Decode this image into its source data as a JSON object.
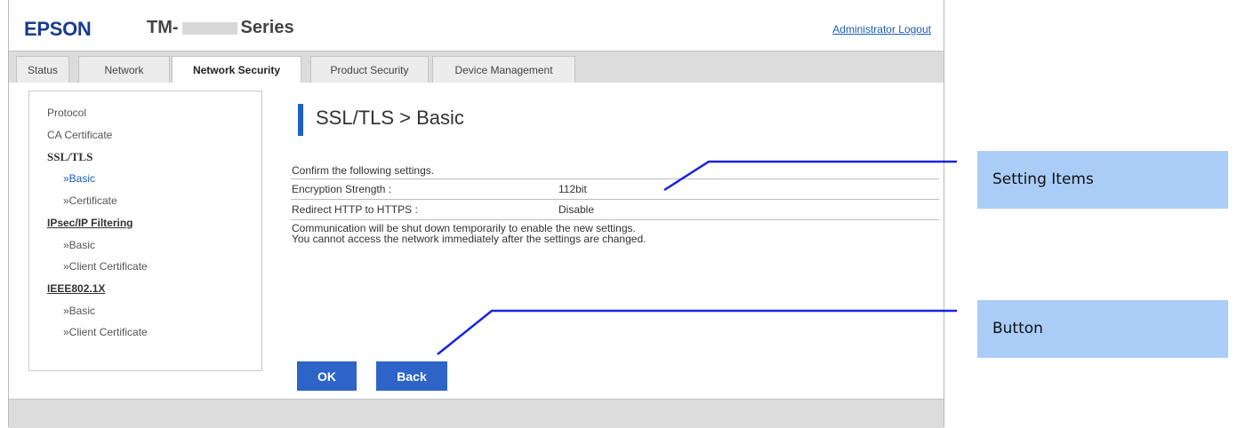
{
  "header": {
    "logo": "EPSON",
    "model_prefix": "TM-",
    "model_suffix": "Series",
    "logout": "Administrator Logout"
  },
  "tabs": [
    {
      "label": "Status"
    },
    {
      "label": "Network"
    },
    {
      "label": "Network Security",
      "active": true
    },
    {
      "label": "Product Security"
    },
    {
      "label": "Device Management"
    }
  ],
  "sidebar": {
    "protocol": "Protocol",
    "ca_certificate": "CA Certificate",
    "ssl_tls": "SSL/TLS",
    "ssl_basic": "»Basic",
    "ssl_certificate": "»Certificate",
    "ipsec": "IPsec/IP Filtering",
    "ipsec_basic": "»Basic",
    "ipsec_client_cert": "»Client Certificate",
    "ieee": "IEEE802.1X",
    "ieee_basic": "»Basic",
    "ieee_client_cert": "»Client Certificate"
  },
  "main": {
    "title": "SSL/TLS > Basic",
    "confirm": "Confirm the following settings.",
    "rows": [
      {
        "key": "Encryption Strength :",
        "value": "112bit"
      },
      {
        "key": "Redirect HTTP to HTTPS :",
        "value": "Disable"
      }
    ],
    "note_line1": "Communication will be shut down temporarily to enable the new settings.",
    "note_line2": "You cannot access the network immediately after the settings are changed.",
    "ok_label": "OK",
    "back_label": "Back"
  },
  "callouts": {
    "setting_items": "Setting Items",
    "button": "Button"
  },
  "colors": {
    "accent": "#2e64c8",
    "callout_bg": "#a9cdf7",
    "callout_line": "#1a23e0",
    "logo": "#1a3b8f"
  }
}
